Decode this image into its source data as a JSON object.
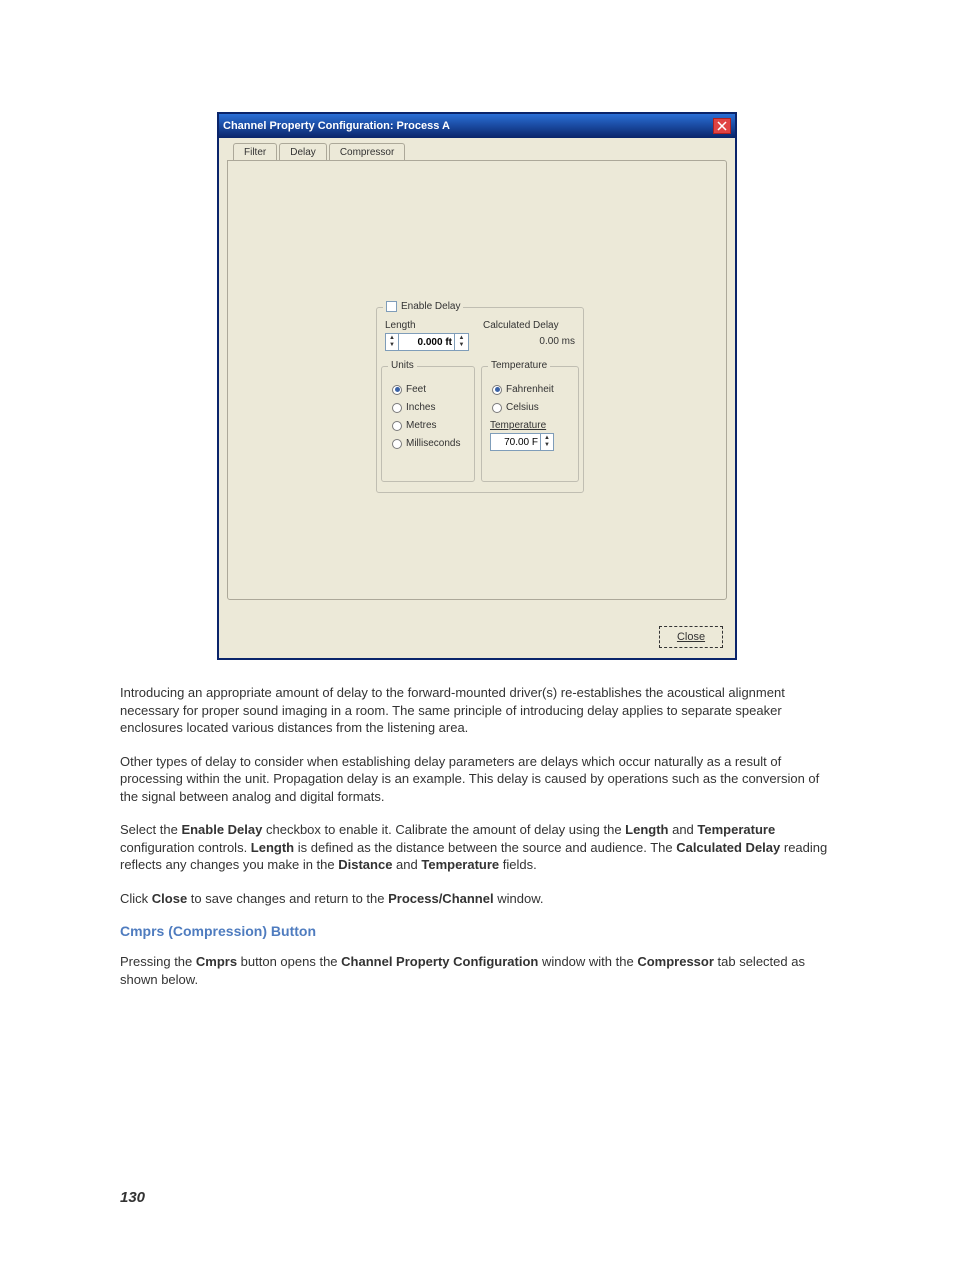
{
  "dialog": {
    "title": "Channel Property Configuration: Process A",
    "tabs": {
      "filter": "Filter",
      "delay": "Delay",
      "compressor": "Compressor"
    },
    "enable_label": "Enable Delay",
    "length_label": "Length",
    "length_value": "0.000 ft",
    "calc_label": "Calculated Delay",
    "calc_value": "0.00 ms",
    "units_legend": "Units",
    "units": {
      "feet": "Feet",
      "inches": "Inches",
      "metres": "Metres",
      "ms": "Milliseconds"
    },
    "temp_legend": "Temperature",
    "temp_units": {
      "f": "Fahrenheit",
      "c": "Celsius"
    },
    "temp_field_label": "Temperature",
    "temp_value": "70.00 F",
    "close_btn": "Close"
  },
  "paragraphs": {
    "p1": "Introducing an appropriate amount of delay to the forward-mounted driver(s) re-establishes the acoustical alignment necessary for proper sound imaging in a room. The same principle of introducing delay applies to separate speaker enclosures located various distances from the listening area.",
    "p2": "Other types of delay to consider when establishing delay parameters are delays which occur naturally as a result of processing within the unit. Propagation delay is an example. This delay is caused by operations such as the conversion of the signal between analog and digital formats.",
    "p3_1": "Select the ",
    "p3_b1": "Enable Delay",
    "p3_2": " checkbox to enable it. Calibrate the amount of delay using the ",
    "p3_b2": "Length",
    "p3_3": " and ",
    "p3_b3": "Temperature",
    "p3_4": " configuration controls. ",
    "p3_b4": "Length",
    "p3_5": " is defined as the distance between the source and audience. The ",
    "p3_b5": "Calculated Delay",
    "p3_6": " reading reflects any changes you make in the ",
    "p3_b6": "Distance",
    "p3_7": " and ",
    "p3_b7": "Temperature",
    "p3_8": " fields.",
    "p4_1": "Click ",
    "p4_b1": "Close",
    "p4_2": " to save changes and return to the ",
    "p4_b2": "Process/Channel",
    "p4_3": " window.",
    "h3": "Cmprs (Compression) Button",
    "p5_1": "Pressing the ",
    "p5_b1": "Cmprs",
    "p5_2": " button opens the ",
    "p5_b2": "Channel Property Configuration",
    "p5_3": " window with the ",
    "p5_b3": "Compressor",
    "p5_4": " tab selected as shown below."
  },
  "page_number": "130"
}
